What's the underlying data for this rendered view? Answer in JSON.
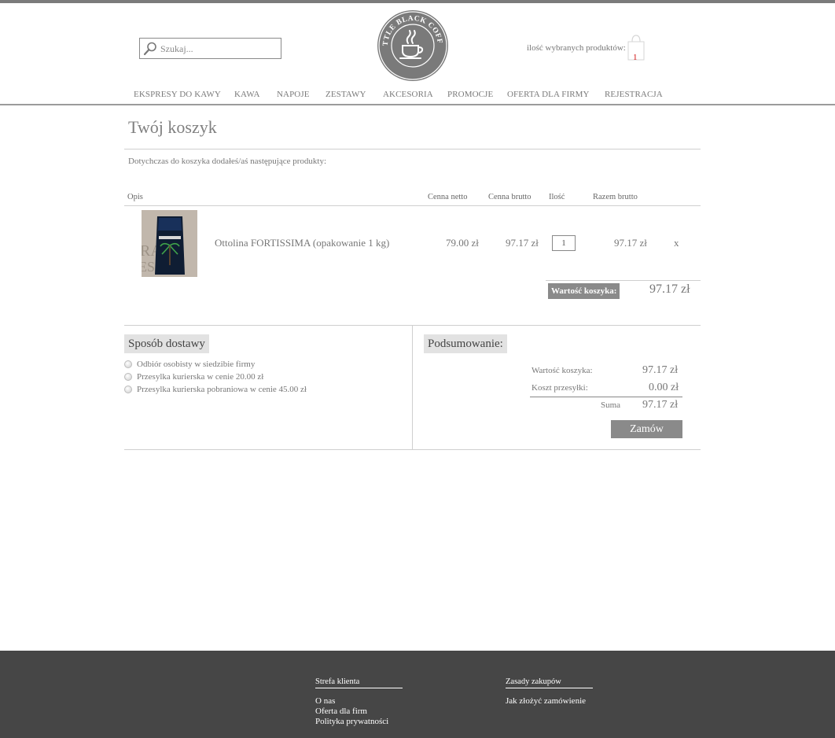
{
  "search": {
    "placeholder": "Szukaj..."
  },
  "logo": {
    "text": "LITTLE BLACK COFFEE"
  },
  "cart": {
    "count_label": "ilość wybranych produktów:",
    "count": "1"
  },
  "nav": [
    "EKSPRESY DO KAWY",
    "KAWA",
    "NAPOJE",
    "ZESTAWY",
    "AKCESORIA",
    "PROMOCJE",
    "OFERTA DLA FIRMY",
    "REJESTRACJA"
  ],
  "page": {
    "title": "Twój koszyk",
    "intro": "Dotychczas do koszyka dodałeś/aś następujące produkty:"
  },
  "table": {
    "headers": {
      "desc": "Opis",
      "net": "Cenna netto",
      "gross": "Cenna brutto",
      "qty": "Ilość",
      "total": "Razem brutto"
    },
    "rows": [
      {
        "name": "Ottolina FORTISSIMA (opakowanie 1 kg)",
        "net": "79.00 zł",
        "gross": "97.17 zł",
        "qty": "1",
        "total": "97.17 zł",
        "remove": "x"
      }
    ],
    "cart_value_label": "Wartość koszyka:",
    "cart_value": "97.17 zł"
  },
  "delivery": {
    "title": "Sposób dostawy",
    "options": [
      "Odbiór osobisty w siedzibie firmy",
      "Przesylka kurierska w cenie 20.00 zł",
      "Przesylka kurierska pobraniowa w cenie 45.00 zł"
    ]
  },
  "summary": {
    "title": "Podsumowanie:",
    "cart_value_label": "Wartość koszyka:",
    "cart_value": "97.17 zł",
    "shipping_label": "Koszt przesyłki:",
    "shipping": "0.00 zł",
    "sum_label": "Suma",
    "sum": "97.17 zł",
    "order_button": "Zamów"
  },
  "footer": {
    "col1": {
      "title": "Strefa klienta",
      "links": [
        "O nas",
        "Oferta dla firm",
        "Polityka prywatności"
      ]
    },
    "col2": {
      "title": "Zasady zakupów",
      "links": [
        "Jak złożyć zamówienie"
      ]
    }
  }
}
